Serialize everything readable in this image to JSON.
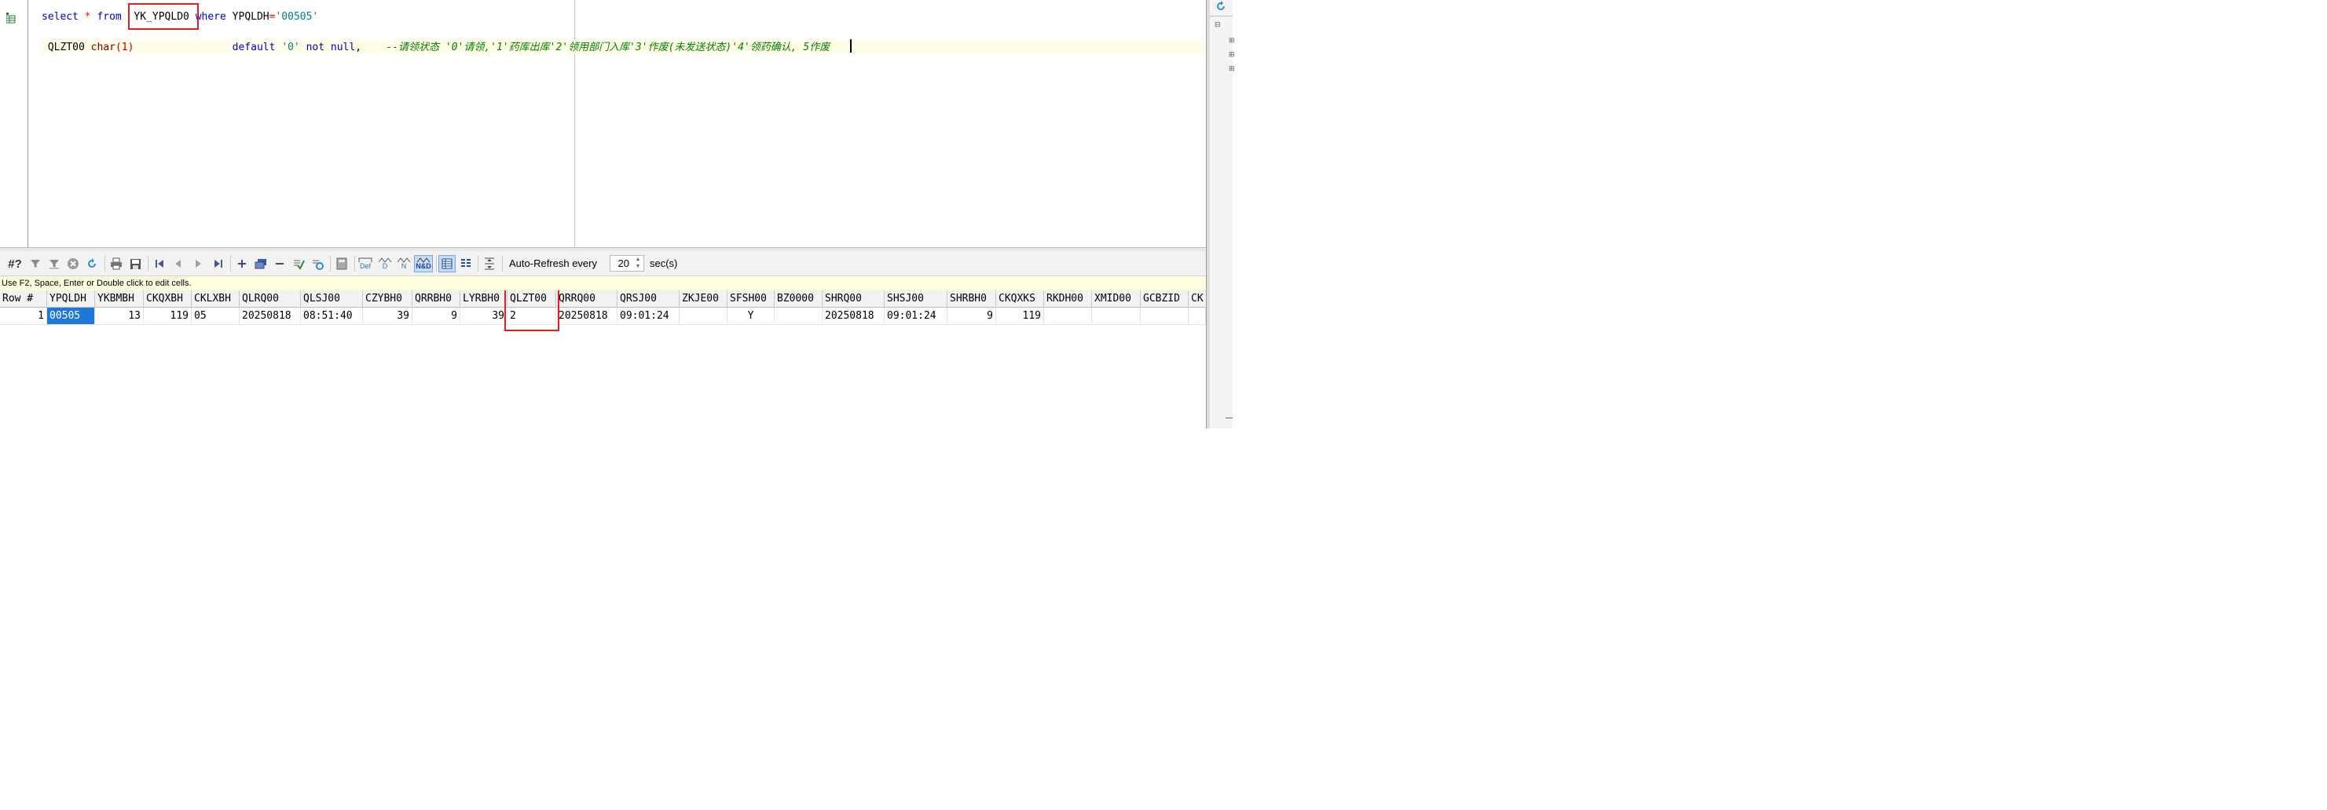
{
  "editor": {
    "line1": {
      "kw_select": "select",
      "star": "*",
      "kw_from": "from",
      "table": "YK_YPQLD0",
      "kw_where": "where",
      "column": "YPQLDH",
      "op": "=",
      "value": "'00505'"
    },
    "line2": {
      "column": "QLZT00",
      "type": "char",
      "paren_open": "(",
      "size": "1",
      "paren_close": ")",
      "kw_default": "default",
      "default_value": "'0'",
      "kw_not": "not",
      "kw_null": "null",
      "comma": ",",
      "comment": "--请领状态 '0'请领,'1'药库出库'2'领用部门入库'3'作废(未发送状态)'4'领药确认, 5作废"
    }
  },
  "toolbar": {
    "icons": [
      "count-icon",
      "filter-icon",
      "clear-filter-icon",
      "cancel-icon",
      "refresh-icon",
      "print-icon",
      "save-icon",
      "first-record-icon",
      "prior-record-icon",
      "next-record-icon",
      "last-record-icon",
      "insert-record-icon",
      "duplicate-record-icon",
      "delete-record-icon",
      "post-changes-icon",
      "refresh-record-icon",
      "calculator-icon",
      "default-icon",
      "d-icon",
      "n-icon",
      "n-and-d-icon",
      "grid-view-icon",
      "form-view-icon",
      "split-icon"
    ],
    "count_label": "#?",
    "def_label": "Def",
    "d_label": "D",
    "n_label": "N",
    "nd_label": "N&D",
    "auto_refresh_label": "Auto-Refresh every",
    "auto_refresh_value": "20",
    "secs_label": "sec(s)"
  },
  "hint": "Use F2, Space, Enter or Double click to edit cells.",
  "grid": {
    "columns": [
      "Row #",
      "YPQLDH",
      "YKBMBH",
      "CKQXBH",
      "CKLXBH",
      "QLRQ00",
      "QLSJ00",
      "CZYBH0",
      "QRRBH0",
      "LYRBH0",
      "QLZT00",
      "QRRQ00",
      "QRSJ00",
      "ZKJE00",
      "SFSH00",
      "BZ0000",
      "SHRQ00",
      "SHSJ00",
      "SHRBH0",
      "CKQXKS",
      "RKDH00",
      "XMID00",
      "GCBZID",
      "CK"
    ],
    "rows": [
      [
        "1",
        "00505",
        "13",
        "119",
        "05",
        "20250818",
        "08:51:40",
        "39",
        "9",
        "39",
        "2",
        "20250818",
        "09:01:24",
        "",
        "Y",
        "",
        "20250818",
        "09:01:24",
        "9",
        "119",
        "",
        "",
        "",
        ""
      ]
    ]
  },
  "colors": {
    "keyword": "#0000c8",
    "string": "#008080",
    "comment": "#008000",
    "highlight_box": "#e02020",
    "selected_cell": "#1e78d8",
    "hint_bg": "#fffde0"
  }
}
